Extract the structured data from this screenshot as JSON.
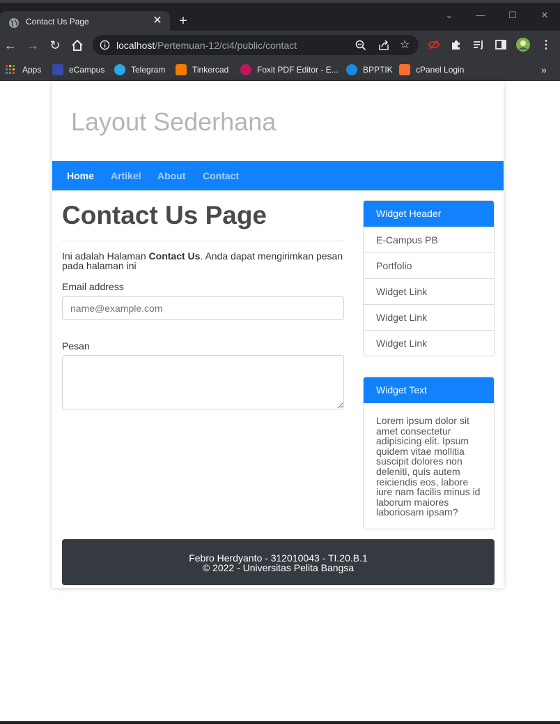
{
  "browser": {
    "tab_title": "Contact Us Page",
    "tab_close": "✕",
    "new_tab": "+",
    "url_host": "localhost",
    "url_path": "/Pertemuan-12/ci4/public/contact",
    "bookmarks": [
      "Apps",
      "eCampus",
      "Telegram",
      "Tinkercad",
      "Foxit PDF Editor - E...",
      "BPPTIK",
      "cPanel Login"
    ],
    "bookmarks_more": "»"
  },
  "site": {
    "title": "Layout Sederhana",
    "nav": [
      "Home",
      "Artikel",
      "About",
      "Contact"
    ]
  },
  "content": {
    "heading": "Contact Us Page",
    "intro_before": "Ini adalah Halaman ",
    "intro_bold": "Contact Us",
    "intro_after": ". Anda dapat mengirimkan pesan pada halaman ini",
    "email_label": "Email address",
    "email_placeholder": "name@example.com",
    "message_label": "Pesan"
  },
  "sidebar": {
    "widget1_header": "Widget Header",
    "widget1_links": [
      "E-Campus PB",
      "Portfolio",
      "Widget Link",
      "Widget Link",
      "Widget Link"
    ],
    "widget2_header": "Widget Text",
    "widget2_text": "Lorem ipsum dolor sit amet consectetur adipisicing elit. Ipsum quidem vitae mollitia suscipit dolores non deleniti, quis autem reiciendis eos, labore iure nam facilis minus id laborum maiores laboriosam ipsam?"
  },
  "footer": {
    "line1": "Febro Herdyanto - 312010043 - TI.20.B.1",
    "line2": "© 2022 - Universitas Pelita Bangsa"
  },
  "colors": {
    "primary": "#1182fb",
    "footer_bg": "#343a40",
    "site_title": "#b5b5b5"
  }
}
